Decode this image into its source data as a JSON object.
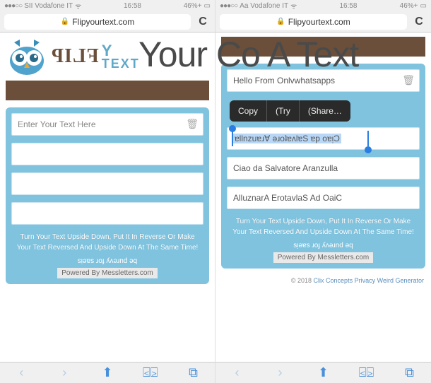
{
  "overlay_title": "Your Co A Text",
  "left": {
    "status": {
      "carrier": "SII Vodafone IT",
      "wifi": "⋮",
      "time": "16:58",
      "battery": "46%+"
    },
    "address": {
      "lock": "🔒",
      "url": "Flipyourtext.com",
      "refresh": "C"
    },
    "logo": {
      "flip": "FLIP",
      "y": "Y",
      "text": "TEXT"
    },
    "card": {
      "input_placeholder": "Enter Your Text Here",
      "row2": "",
      "row3": "",
      "row4": "",
      "info1": "Turn Your Text Upside Down, Put It In Reverse Or Make",
      "info2": "Your Text Reversed And Upside Down At The Same Time!",
      "ideas": "sᴉǝɐs ɹoɟ ʎʌǝɹnd ǝq",
      "powered": "Powered By Messletters.com"
    }
  },
  "right": {
    "status": {
      "carrier": "Aa Vodafone IT",
      "wifi": "⋮",
      "time": "16:58",
      "battery": "46%+"
    },
    "address": {
      "lock": "🔒",
      "url": "Flipyourtext.com",
      "refresh": "C"
    },
    "card": {
      "input_value": "Hello From Onlvwhatsapps",
      "popup": {
        "copy": "Copy",
        "try": "(Try",
        "share": "(Share…"
      },
      "row2": "ɐllnzuɐɹ∀ ǝɹoʇɐʌlɐS ɐp oɐᴉƆ",
      "row3": "Ciao da Salvatore Aranzulla",
      "row4": "AlluznarA ErotavlaS Ad OaiC",
      "info1": "Turn Your Text Upside Down, Put It In Reverse Or Make",
      "info2": "Your Text Reversed And Upside Down At The Same Time!",
      "ideas": "sᴉǝɐs ɹoɟ ʎʌǝɹnd ǝq",
      "powered": "Powered By Messletters.com"
    },
    "footer": {
      "year": "© 2018",
      "link1": "Clix Concepts",
      "link2": "Privacy",
      "link3": "Weird Generator"
    }
  }
}
